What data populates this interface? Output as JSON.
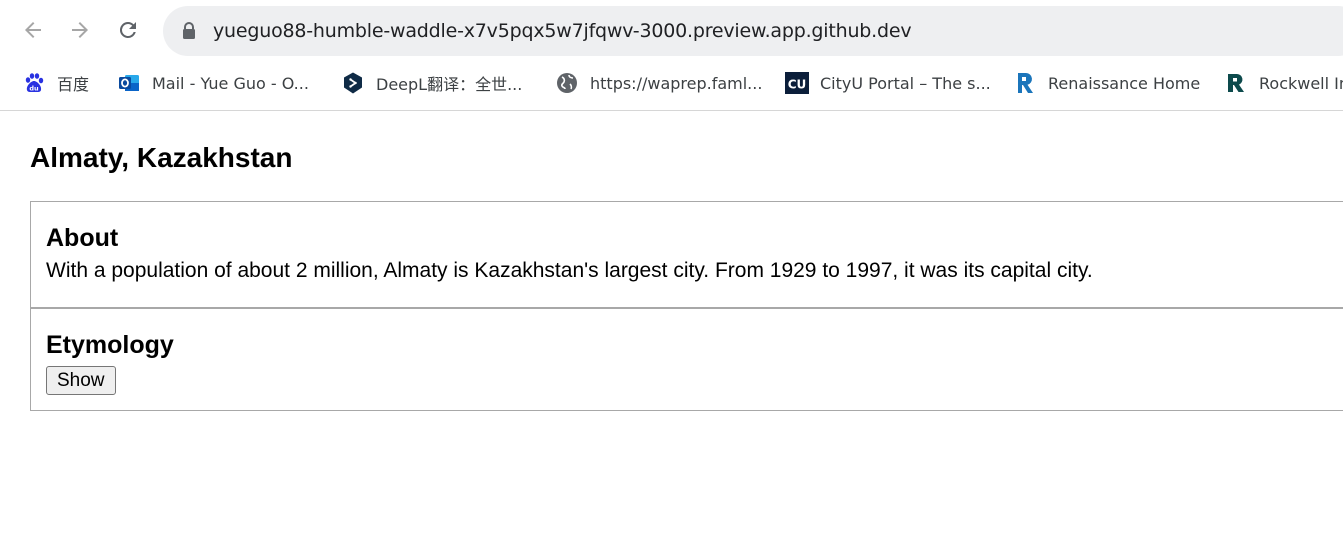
{
  "browser": {
    "url": "yueguo88-humble-waddle-x7v5pqx5w7jfqwv-3000.preview.app.github.dev",
    "bookmarks": [
      {
        "label": "百度",
        "icon": "baidu-icon"
      },
      {
        "label": "Mail - Yue Guo - O...",
        "icon": "outlook-icon"
      },
      {
        "label": "DeepL翻译：全世...",
        "icon": "deepl-icon"
      },
      {
        "label": "https://waprep.faml...",
        "icon": "globe-icon"
      },
      {
        "label": "CityU Portal – The s...",
        "icon": "cityu-icon"
      },
      {
        "label": "Renaissance Home",
        "icon": "renaissance-icon"
      },
      {
        "label": "Rockwell In",
        "icon": "rockwell-icon"
      }
    ]
  },
  "page": {
    "title": "Almaty, Kazakhstan",
    "about": {
      "heading": "About",
      "text": "With a population of about 2 million, Almaty is Kazakhstan's largest city. From 1929 to 1997, it was its capital city."
    },
    "etymology": {
      "heading": "Etymology",
      "button_label": "Show"
    }
  },
  "colors": {
    "omnibox_bg": "#eeeff1",
    "border": "#a8a8a8",
    "baidu": "#2932e1",
    "outlook": "#0a64c8",
    "deepl": "#0f2b46",
    "cityu": "#0b1e3a",
    "renaissance": "#1b75bb",
    "rockwell": "#0d4a4c"
  }
}
